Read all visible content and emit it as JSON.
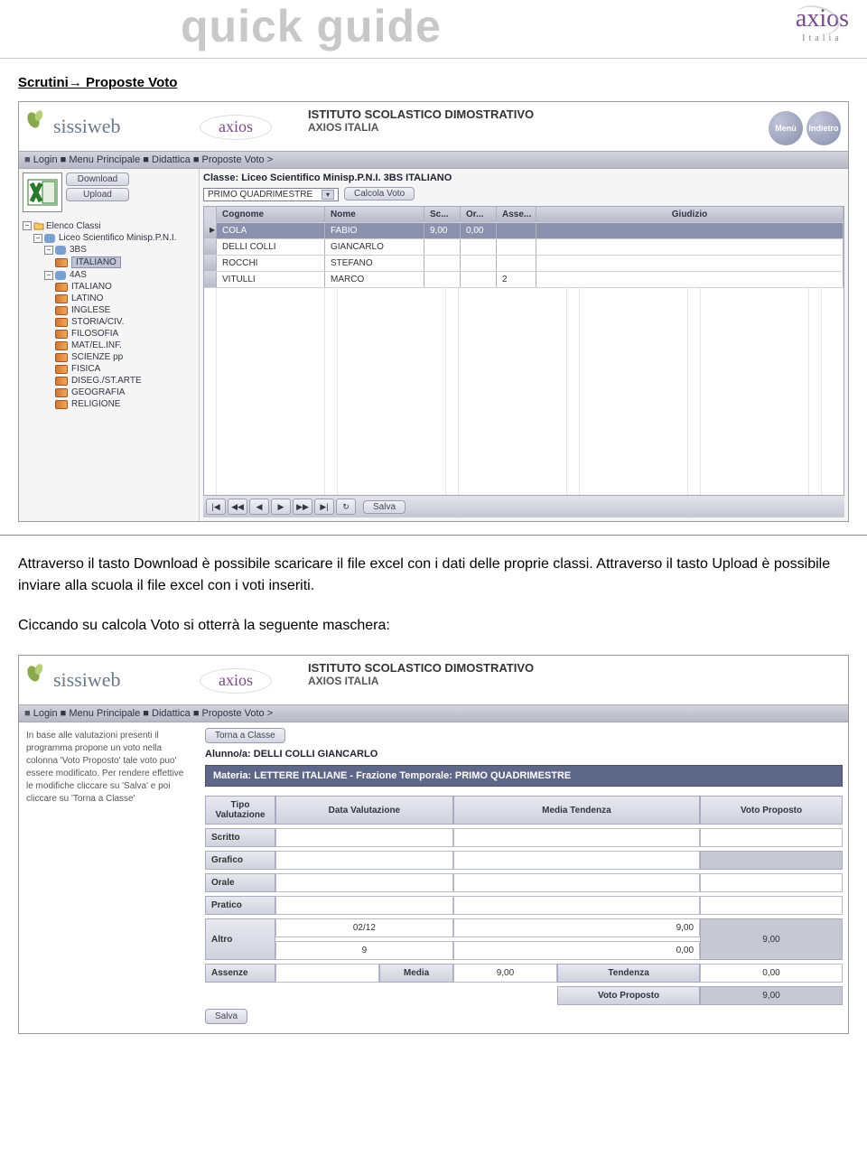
{
  "header": {
    "quick_guide": "quick guide",
    "axios": "axios",
    "italia": "Italia"
  },
  "section_title": "Scrutini→ Proposte Voto",
  "ss1": {
    "logo": "sissiweb",
    "mini_axios": "axios",
    "institute_name": "ISTITUTO SCOLASTICO DIMOSTRATIVO",
    "institute_sub": "AXIOS ITALIA",
    "nav_menu": "Menù",
    "nav_back": "Indietro",
    "breadcrumb": "Login ■ Menu Principale ■ Didattica ■ Proposte Voto >",
    "download": "Download",
    "upload": "Upload",
    "tree": {
      "root": "Elenco Classi",
      "liceo": "Liceo Scientifico Minisp.P.N.I.",
      "c3bs": "3BS",
      "c3bs_italiano": "ITALIANO",
      "c4as": "4AS",
      "subjects": [
        "ITALIANO",
        "LATINO",
        "INGLESE",
        "STORIA/CIV.",
        "FILOSOFIA",
        "MAT/EL.INF.",
        "SCIENZE pp",
        "FISICA",
        "DISEG./ST.ARTE",
        "GEOGRAFIA",
        "RELIGIONE"
      ]
    },
    "class_line": "Classe: Liceo Scientifico Minisp.P.N.I. 3BS ITALIANO",
    "periodo": "PRIMO QUADRIMESTRE",
    "calcola": "Calcola Voto",
    "cols": {
      "cognome": "Cognome",
      "nome": "Nome",
      "sc": "Sc...",
      "or": "Or...",
      "asse": "Asse...",
      "giudizio": "Giudizio"
    },
    "rows": [
      {
        "cognome": "COLA",
        "nome": "FABIO",
        "sc": "9,00",
        "or": "0,00",
        "asse": "",
        "selected": true
      },
      {
        "cognome": "DELLI COLLI",
        "nome": "GIANCARLO",
        "sc": "",
        "or": "",
        "asse": ""
      },
      {
        "cognome": "ROCCHI",
        "nome": "STEFANO",
        "sc": "",
        "or": "",
        "asse": ""
      },
      {
        "cognome": "VITULLI",
        "nome": "MARCO",
        "sc": "",
        "or": "",
        "asse": "2"
      }
    ],
    "salva": "Salva"
  },
  "para1": "Attraverso il tasto Download è possibile scaricare il file excel con i dati delle proprie classi. Attraverso il tasto Upload è possibile inviare alla scuola il file excel con i voti inseriti.",
  "para2": "Ciccando su calcola Voto si otterrà la seguente maschera:",
  "ss2": {
    "logo": "sissiweb",
    "mini_axios": "axios",
    "institute_name": "ISTITUTO SCOLASTICO DIMOSTRATIVO",
    "institute_sub": "AXIOS ITALIA",
    "breadcrumb": "Login ■ Menu Principale ■ Didattica ■ Proposte Voto >",
    "help_text": "In base alle valutazioni presenti il programma propone un voto nella colonna 'Voto Proposto' tale voto puo' essere modificato. Per rendere effettive le modifiche cliccare su 'Salva' e poi cliccare su 'Torna a Classe'",
    "torna": "Torna a Classe",
    "alunno": "Alunno/a: DELLI COLLI GIANCARLO",
    "materia": "Materia: LETTERE ITALIANE - Frazione Temporale: PRIMO QUADRIMESTRE",
    "hdrs": {
      "tipo": "Tipo Valutazione",
      "data": "Data Valutazione",
      "media": "Media Tendenza",
      "voto": "Voto Proposto"
    },
    "types": {
      "scritto": "Scritto",
      "grafico": "Grafico",
      "orale": "Orale",
      "pratico": "Pratico",
      "altro": "Altro",
      "assenze": "Assenze",
      "media": "Media",
      "tendenza": "Tendenza",
      "voto_prop": "Voto Proposto"
    },
    "vals": {
      "altro_date": "02/12",
      "altro_n": "9",
      "altro_media": "9,00",
      "altro_tend": "0,00",
      "altro_voto": "9,00",
      "assenze_media": "9,00",
      "assenze_tend": "0,00",
      "assenze_voto": "9,00"
    },
    "salva": "Salva"
  }
}
